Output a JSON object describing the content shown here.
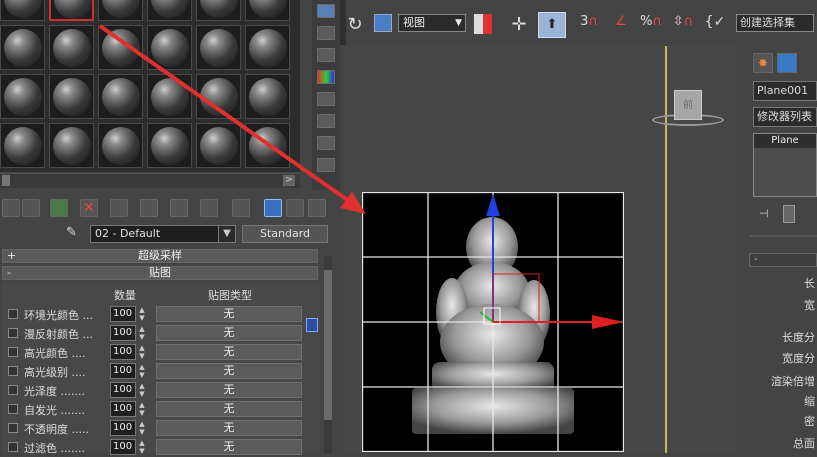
{
  "material_editor": {
    "material_name": "02 - Default",
    "material_type": "Standard",
    "rollouts": {
      "supersampling": "超级采样",
      "maps": "贴图"
    },
    "maps_header": {
      "amount": "数量",
      "map_type": "贴图类型"
    },
    "map_rows": [
      {
        "label": "环境光颜色 ...",
        "amount": "100",
        "map": "无"
      },
      {
        "label": "漫反射颜色 ...",
        "amount": "100",
        "map": "无"
      },
      {
        "label": "高光颜色 ....",
        "amount": "100",
        "map": "无"
      },
      {
        "label": "高光级别 ....",
        "amount": "100",
        "map": "无"
      },
      {
        "label": "光泽度 .......",
        "amount": "100",
        "map": "无"
      },
      {
        "label": "自发光 .......",
        "amount": "100",
        "map": "无"
      },
      {
        "label": "不透明度 .....",
        "amount": "100",
        "map": "无"
      },
      {
        "label": "过滤色 .......",
        "amount": "100",
        "map": "无"
      }
    ]
  },
  "main_toolbar": {
    "view_dropdown": "视图",
    "snap_label": "3",
    "percent_label": "%",
    "selection_set_placeholder": "创建选择集"
  },
  "viewport": {
    "viewcube_face": "前"
  },
  "command_panel": {
    "object_name": "Plane001",
    "modifier_list": "修改器列表",
    "stack_item": "Plane",
    "collapse_sign": "-",
    "params": [
      "长",
      "宽",
      "长度分",
      "宽度分",
      "渲染倍增",
      "缩",
      "密",
      "总面"
    ]
  },
  "colors": {
    "annotation_arrow": "#e03030",
    "axis_z": "#2040e0",
    "axis_x": "#e02020",
    "axis_y": "#20c020",
    "frame": "#c8b85a"
  }
}
